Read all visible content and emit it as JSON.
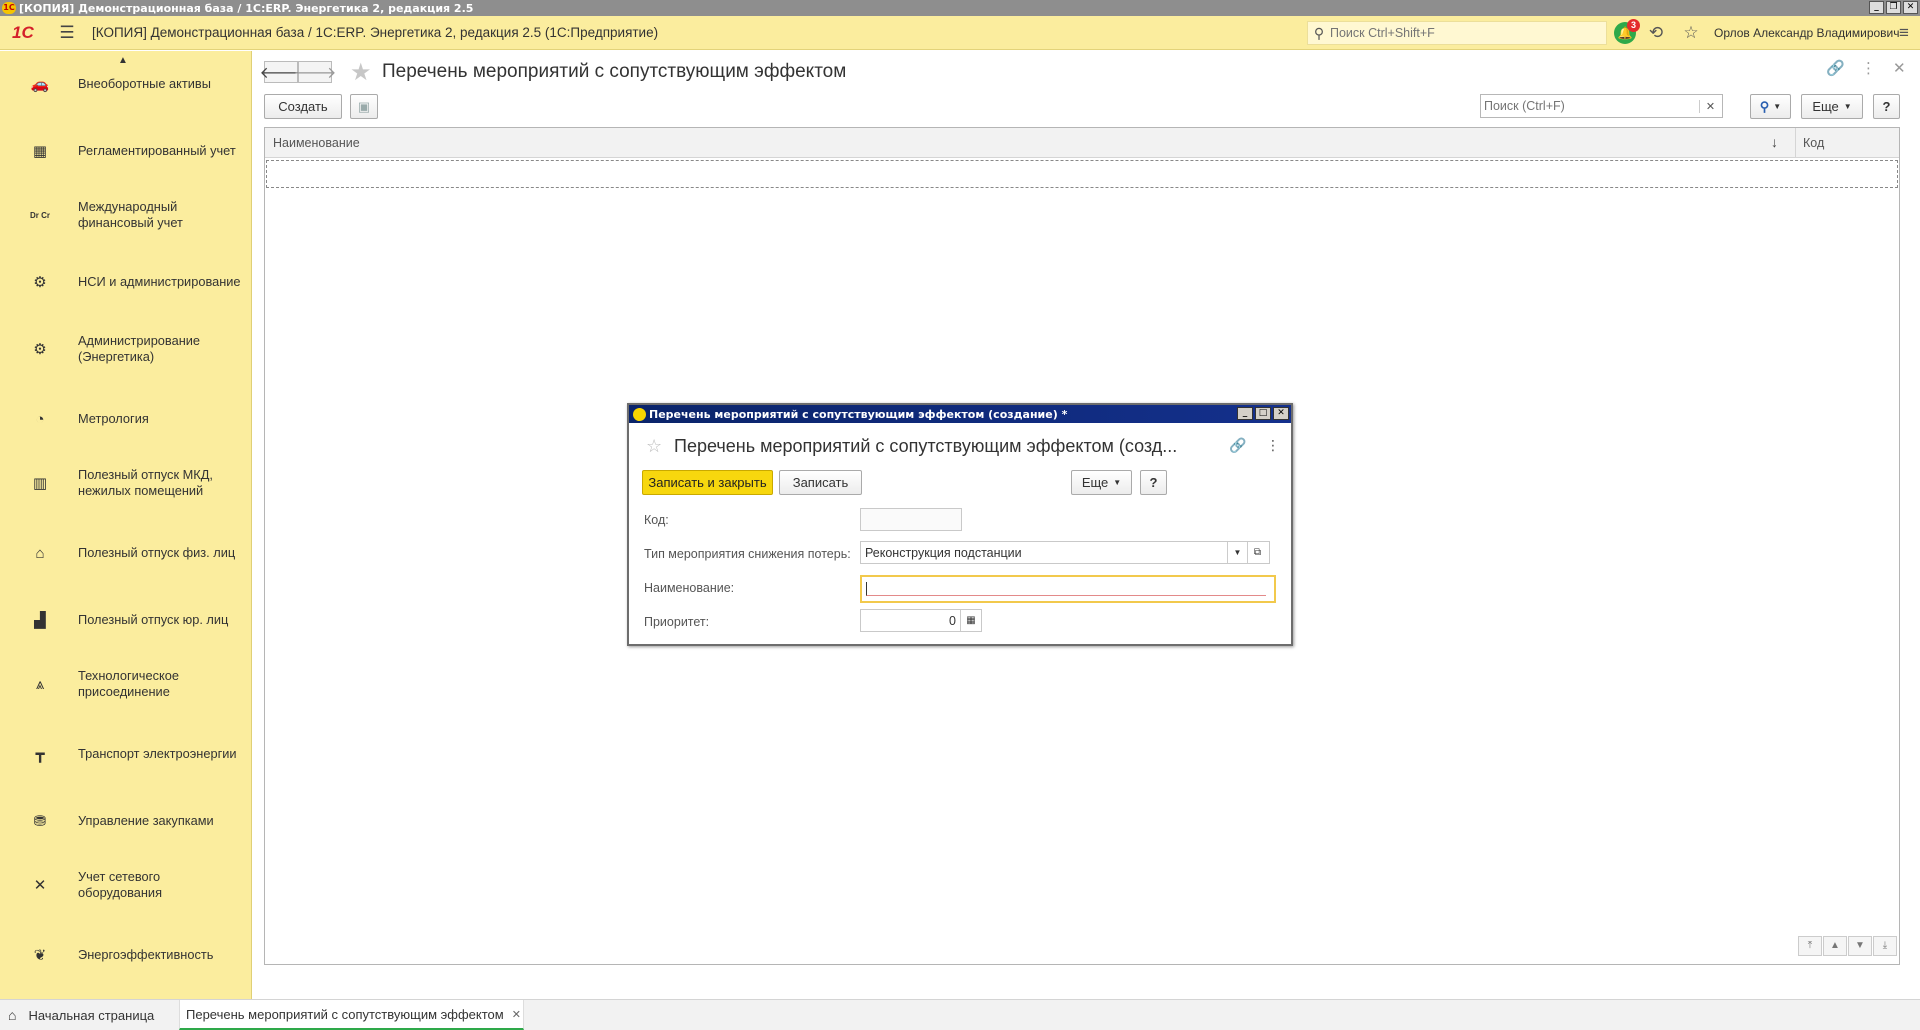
{
  "window": {
    "os_title": "[КОПИЯ] Демонстрационная база / 1С:ERP. Энергетика 2, редакция 2.5",
    "logo_text": "1С"
  },
  "header": {
    "brand": "1С",
    "app_title": "[КОПИЯ] Демонстрационная база / 1С:ERP. Энергетика 2, редакция 2.5  (1С:Предприятие)",
    "search_placeholder": "Поиск Ctrl+Shift+F",
    "notifications_count": "3",
    "user_name": "Орлов Александр Владимирович"
  },
  "sidebar": {
    "items": [
      {
        "label": "Внеоборотные активы",
        "icon": "car-icon"
      },
      {
        "label": "Регламентированный учет",
        "icon": "calculator-icon"
      },
      {
        "label": "Международный финансовый учет",
        "icon": "dr-cr-icon",
        "icon_text": "Dr Cr"
      },
      {
        "label": "НСИ и администрирование",
        "icon": "gear-icon"
      },
      {
        "label": "Администрирование (Энергетика)",
        "icon": "gear-icon"
      },
      {
        "label": "Метрология",
        "icon": "gauge-icon"
      },
      {
        "label": "Полезный отпуск МКД, нежилых помещений",
        "icon": "apartment-building-icon"
      },
      {
        "label": "Полезный отпуск физ. лиц",
        "icon": "house-icon"
      },
      {
        "label": "Полезный отпуск юр. лиц",
        "icon": "factory-icon"
      },
      {
        "label": "Технологическое присоединение",
        "icon": "power-tower-icon"
      },
      {
        "label": "Транспорт электроэнергии",
        "icon": "power-pole-icon"
      },
      {
        "label": "Управление закупками",
        "icon": "shopping-basket-icon"
      },
      {
        "label": "Учет сетевого оборудования",
        "icon": "tools-icon"
      },
      {
        "label": "Энергоэффективность",
        "icon": "leaf-icon"
      }
    ]
  },
  "main": {
    "title": "Перечень мероприятий с сопутствующим эффектом",
    "create_label": "Создать",
    "search_placeholder": "Поиск (Ctrl+F)",
    "more_label": "Еще",
    "help_label": "?",
    "columns": [
      "Наименование",
      "Код"
    ]
  },
  "modal": {
    "window_title": "Перечень мероприятий с сопутствующим эффектом (создание) *",
    "heading": "Перечень мероприятий с сопутствующим эффектом (созд...",
    "save_close_label": "Записать и закрыть",
    "save_label": "Записать",
    "more_label": "Еще",
    "help_label": "?",
    "fields": {
      "code_label": "Код:",
      "code_value": "",
      "type_label": "Тип мероприятия снижения потерь:",
      "type_value": "Реконструкция подстанции",
      "name_label": "Наименование:",
      "name_value": "",
      "priority_label": "Приоритет:",
      "priority_value": "0"
    },
    "accent_color": "#f7d70e"
  },
  "taskbar": {
    "home_label": "Начальная страница",
    "active_tab_label": "Перечень мероприятий с сопутствующим эффектом"
  },
  "colors": {
    "panel_yellow": "#fbed9e",
    "primary_button": "#f7d70e",
    "active_tab_underline": "#2ea94a",
    "notification_badge": "#e42c2c"
  }
}
